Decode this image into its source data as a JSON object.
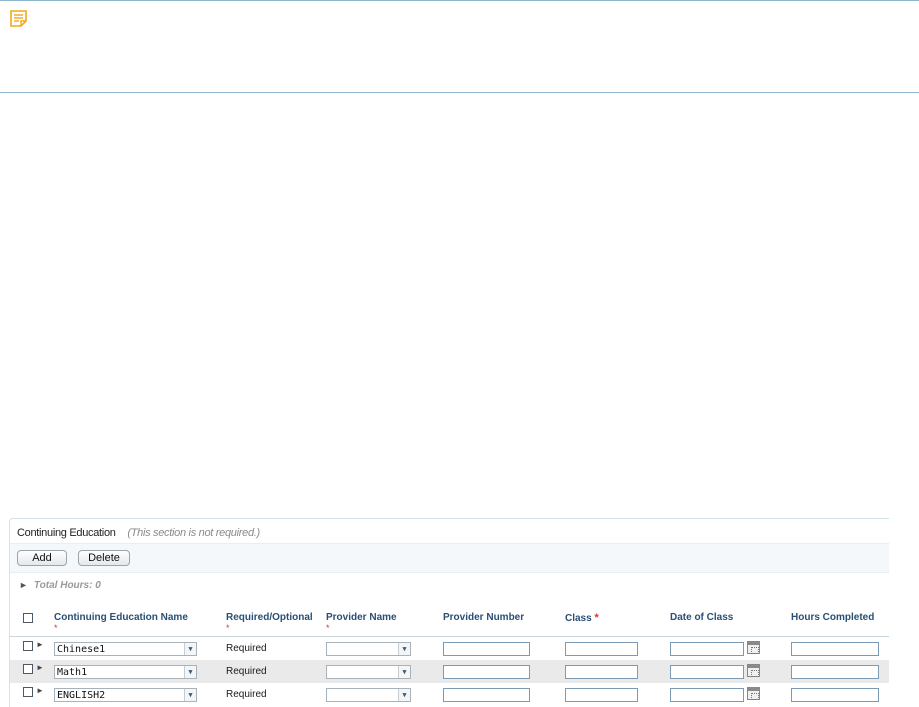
{
  "section": {
    "title": "Continuing Education",
    "note": "(This section is not required.)",
    "total_hours": "Total Hours: 0"
  },
  "buttons": {
    "add": "Add",
    "delete": "Delete"
  },
  "columns": {
    "name": "Continuing Education Name",
    "required": "Required/Optional",
    "provider_name": "Provider Name",
    "provider_number": "Provider Number",
    "class": "Class",
    "date": "Date of Class",
    "hours": "Hours Completed",
    "required_marker": "*"
  },
  "rows": [
    {
      "name": "Chinese1",
      "required": "Required",
      "provider_name": "",
      "provider_number": "",
      "class": "",
      "date": "",
      "hours": ""
    },
    {
      "name": "Math1",
      "required": "Required",
      "provider_name": "",
      "provider_number": "",
      "class": "",
      "date": "",
      "hours": ""
    },
    {
      "name": "ENGLISH2",
      "required": "Required",
      "provider_name": "",
      "provider_number": "",
      "class": "",
      "date": "",
      "hours": ""
    }
  ],
  "icons": {
    "note": "note-icon",
    "expand": "caret-right-icon",
    "dropdown": "chevron-down-icon",
    "calendar": "calendar-icon"
  },
  "colors": {
    "accent_line": "#8db6cc",
    "header_text": "#2a4f74",
    "required": "#e03030",
    "note_icon": "#f0a91a"
  }
}
